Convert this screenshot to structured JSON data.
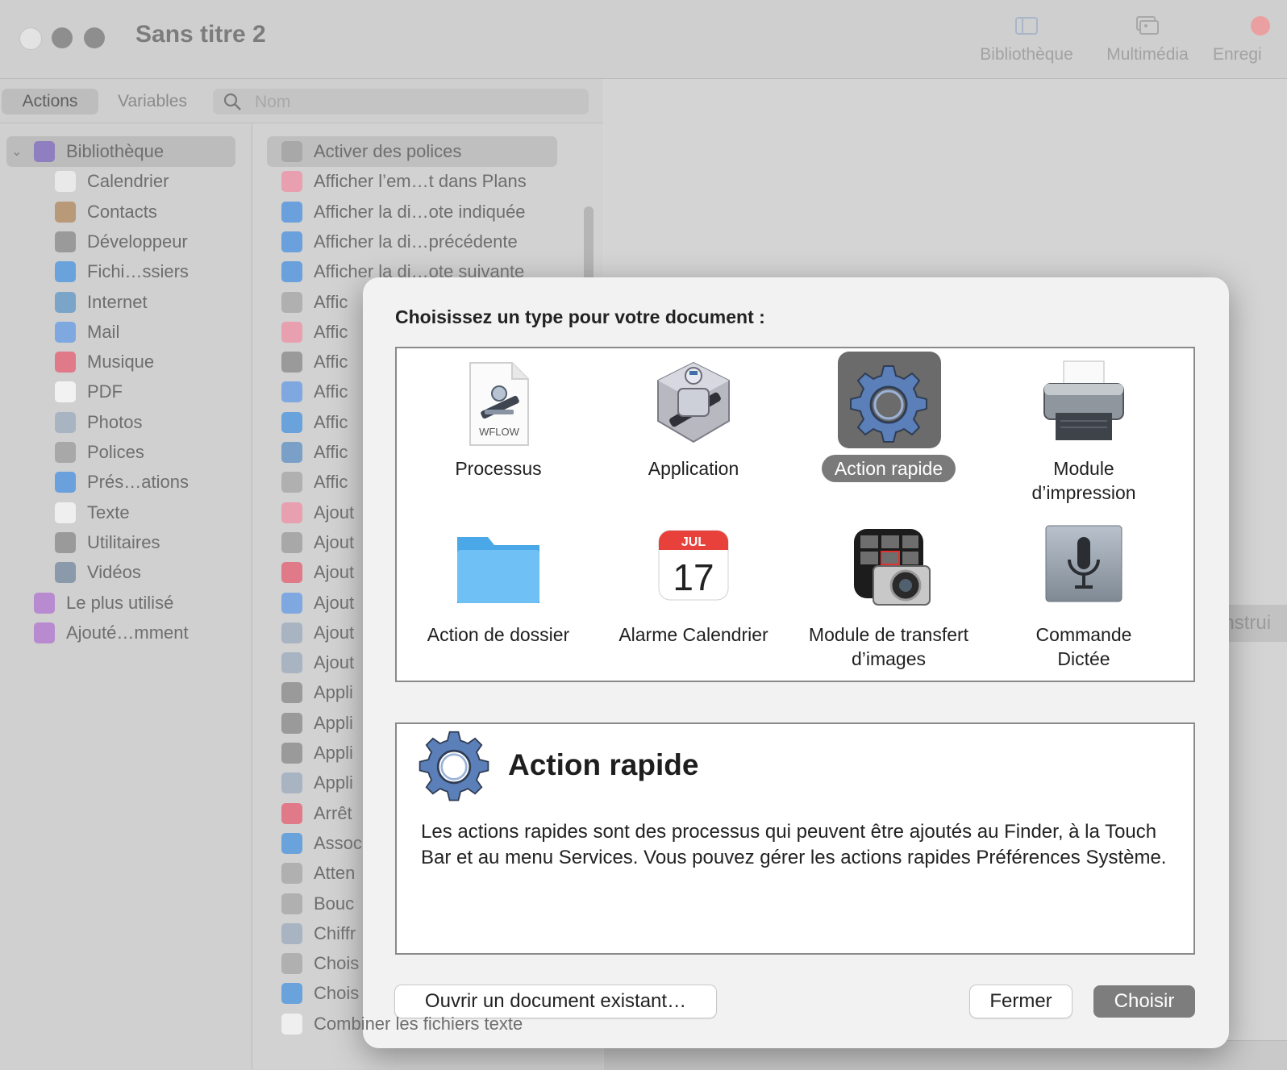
{
  "window": {
    "title": "Sans titre 2",
    "toolbar": [
      {
        "label": "Bibliothèque",
        "icon": "sidebar-icon"
      },
      {
        "label": "Multimédia",
        "icon": "photos-icon"
      },
      {
        "label": "Enregi",
        "icon": "record-icon"
      }
    ]
  },
  "left": {
    "tabs": {
      "actions": "Actions",
      "variables": "Variables"
    },
    "search_placeholder": "Nom",
    "library": [
      {
        "label": "Bibliothèque",
        "icon": "library-icon"
      },
      {
        "label": "Calendrier",
        "icon": "calendar-icon"
      },
      {
        "label": "Contacts",
        "icon": "contacts-icon"
      },
      {
        "label": "Développeur",
        "icon": "developer-icon"
      },
      {
        "label": "Fichi…ssiers",
        "icon": "finder-icon"
      },
      {
        "label": "Internet",
        "icon": "internet-icon"
      },
      {
        "label": "Mail",
        "icon": "mail-icon"
      },
      {
        "label": "Musique",
        "icon": "music-icon"
      },
      {
        "label": "PDF",
        "icon": "pdf-icon"
      },
      {
        "label": "Photos",
        "icon": "photos-icon"
      },
      {
        "label": "Polices",
        "icon": "fonts-icon"
      },
      {
        "label": "Prés…ations",
        "icon": "keynote-icon"
      },
      {
        "label": "Texte",
        "icon": "text-icon"
      },
      {
        "label": "Utilitaires",
        "icon": "utilities-icon"
      },
      {
        "label": "Vidéos",
        "icon": "videos-icon"
      },
      {
        "label": "Le plus utilisé",
        "icon": "smart-folder-icon"
      },
      {
        "label": "Ajouté…mment",
        "icon": "smart-folder-icon"
      }
    ],
    "actions": [
      "Activer des polices",
      "Afficher l’em…t dans Plans",
      "Afficher la di…ote indiquée",
      "Afficher la di…précédente",
      "Afficher la di…ote suivante",
      "Affic",
      "Affic",
      "Affic",
      "Affic",
      "Affic",
      "Affic",
      "Affic",
      "Ajout",
      "Ajout",
      "Ajout",
      "Ajout",
      "Ajout",
      "Ajout",
      "Appli",
      "Appli",
      "Appli",
      "Appli",
      "Arrêt",
      "Assoc",
      "Atten",
      "Bouc",
      "Chiffr",
      "Chois",
      "Chois",
      "Combiner les fichiers texte"
    ]
  },
  "right": {
    "partial_button": "onstrui"
  },
  "sheet": {
    "prompt": "Choisissez un type pour votre document :",
    "types": [
      {
        "label": "Processus",
        "icon": "workflow-document-icon",
        "doc_tag": "WFLOW"
      },
      {
        "label": "Application",
        "icon": "automator-robot-icon"
      },
      {
        "label": "Action rapide",
        "icon": "gear-icon",
        "selected": true
      },
      {
        "label": "Module d’impression",
        "icon": "printer-icon"
      },
      {
        "label": "Action de dossier",
        "icon": "folder-icon"
      },
      {
        "label": "Alarme Calendrier",
        "icon": "calendar-icon",
        "cal_month": "JUL",
        "cal_day": "17"
      },
      {
        "label": "Module de transfert d’images",
        "icon": "image-capture-icon"
      },
      {
        "label": "Commande Dictée",
        "icon": "microphone-icon"
      }
    ],
    "description": {
      "title": "Action rapide",
      "body": "Les actions rapides sont des processus qui peuvent être ajoutés au Finder, à la Touch Bar et au menu Services. Vous pouvez gérer les actions rapides Préférences Système."
    },
    "buttons": {
      "open": "Ouvrir un document existant…",
      "close": "Fermer",
      "choose": "Choisir"
    }
  },
  "colors": {
    "accent_selected": "#6b6b6b",
    "choose_button": "#7d7d7d"
  }
}
